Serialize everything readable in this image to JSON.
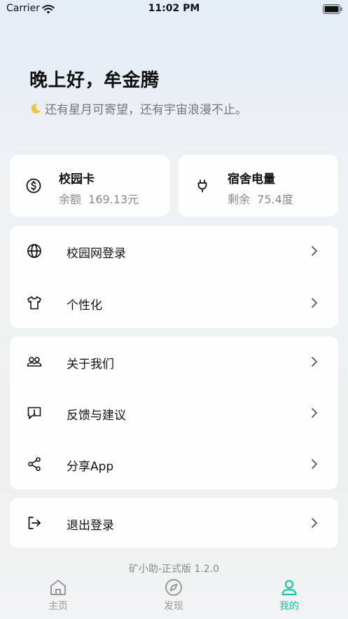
{
  "status_bar": {
    "carrier": "Carrier",
    "time": "11:02 PM"
  },
  "greeting": {
    "title": "晚上好，牟金腾",
    "subtitle": "还有星月可寄望，还有宇宙浪漫不止。"
  },
  "cards": {
    "campus_card": {
      "title": "校园卡",
      "value": "余额  169.13元",
      "icon": "dollar-circle-icon"
    },
    "dorm_power": {
      "title": "宿舍电量",
      "value": "剩余  75.4度",
      "icon": "plug-icon"
    }
  },
  "menu": {
    "group1": [
      {
        "label": "校园网登录",
        "icon": "globe-icon"
      },
      {
        "label": "个性化",
        "icon": "tshirt-icon"
      }
    ],
    "group2": [
      {
        "label": "关于我们",
        "icon": "users-icon"
      },
      {
        "label": "反馈与建议",
        "icon": "feedback-icon"
      },
      {
        "label": "分享App",
        "icon": "share-icon"
      }
    ],
    "group3": [
      {
        "label": "退出登录",
        "icon": "logout-icon"
      }
    ]
  },
  "version": "矿小助-正式版 1.2.0",
  "tabs": [
    {
      "label": "主页",
      "icon": "home-icon",
      "active": false
    },
    {
      "label": "发现",
      "icon": "compass-icon",
      "active": false
    },
    {
      "label": "我的",
      "icon": "user-icon",
      "active": true
    }
  ],
  "colors": {
    "accent": "#1ec2a0",
    "inactive": "#999999"
  }
}
